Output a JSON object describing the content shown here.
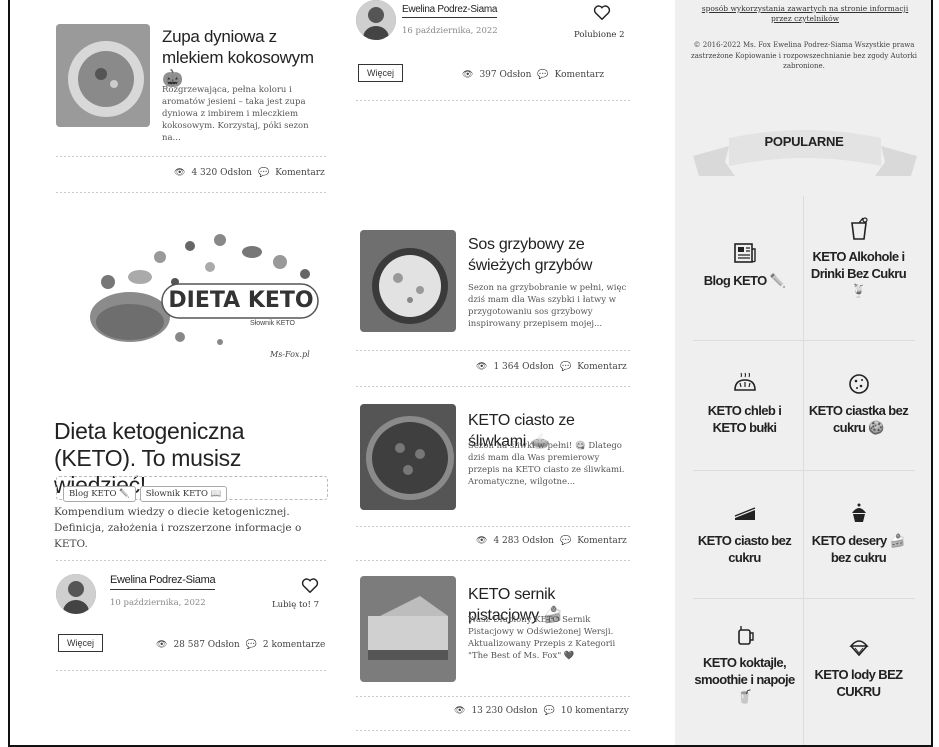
{
  "left": {
    "card1": {
      "title": "Zupa dyniowa z mlekiem kokosowym 🎃",
      "excerpt": "Rozgrzewająca, pełna koloru i aromatów jesieni – taka jest zupa dyniowa z imbirem i mleczkiem kokosowym. Korzystaj, póki sezon na...",
      "views": "4 320 Odsłon",
      "comments": "Komentarz"
    },
    "featured": {
      "banner_text": "DIETA KETO",
      "banner_sub": "Słownik KETO",
      "banner_brand": "Ms-Fox.pl",
      "title": "Dieta ketogeniczna (KETO). To musisz wiedzieć!",
      "tags": [
        "Blog KETO ✏️",
        "Słownik KETO 📖"
      ],
      "excerpt": "Kompendium wiedzy o diecie ketogenicznej. Definicja, założenia i rozszerzone informacje o KETO.",
      "author": "Ewelina Podrez-Siama",
      "date": "10 października, 2022",
      "like_label": "Lubię to! 7",
      "more": "Więcej",
      "views": "28 587 Odsłon",
      "comments": "2 komentarze"
    }
  },
  "middle": {
    "top": {
      "author": "Ewelina Podrez-Siama",
      "date": "16 października, 2022",
      "like_label": "Polubione 2",
      "more": "Więcej",
      "views": "397 Odsłon",
      "comments": "Komentarz"
    },
    "card2": {
      "title": "Sos grzybowy ze świeżych grzybów",
      "excerpt": "Sezon na grzybobranie w pełni, więc dziś mam dla Was szybki i łatwy w przygotowaniu sos grzybowy inspirowany przepisem mojej...",
      "views": "1 364 Odsłon",
      "comments": "Komentarz"
    },
    "card3": {
      "title": "KETO ciasto ze śliwkami 🥧",
      "excerpt": "Sezon na śliwki w pełni! 😋 Dlatego dziś mam dla Was premierowy przepis na KETO ciasto ze śliwkami. Aromatyczne, wilgotne...",
      "views": "4 283 Odsłon",
      "comments": "Komentarz"
    },
    "card4": {
      "title": "KETO sernik pistacjowy 🍰",
      "excerpt": "Wasz Ulubiony KETO Sernik Pistacjowy w Odświeżonej Wersji. Aktualizowany Przepis z Kategorii \"The Best of Ms. Fox\" 💜",
      "views": "13 230 Odsłon",
      "comments": "10 komentarzy"
    }
  },
  "sidebar": {
    "notice_link": "sposób wykorzystania zawartych na stronie informacji przez czytelników",
    "copyright": "© 2016-2022 Ms. Fox Ewelina Podrez-Siama Wszystkie prawa zastrzeżone Kopiowanie i rozpowszechnianie bez zgody Autorki zabronione.",
    "popular_heading": "POPULARNE",
    "categories": [
      {
        "label": "Blog KETO ✏️",
        "icon": "newspaper-icon"
      },
      {
        "label": "KETO Alkohole i Drinki Bez Cukru 🍹",
        "icon": "cocktail-glass-icon"
      },
      {
        "label": "KETO chleb i KETO bułki",
        "icon": "bread-icon"
      },
      {
        "label": "KETO ciastka bez cukru 🍪",
        "icon": "cookie-icon"
      },
      {
        "label": "KETO ciasto bez cukru",
        "icon": "cake-slice-icon"
      },
      {
        "label": "KETO desery 🍰 bez cukru",
        "icon": "cupcake-icon"
      },
      {
        "label": "KETO koktajle, smoothie i napoje 🥤",
        "icon": "jar-drink-icon"
      },
      {
        "label": "KETO lody BEZ CUKRU",
        "icon": "ice-cream-icon"
      }
    ]
  }
}
